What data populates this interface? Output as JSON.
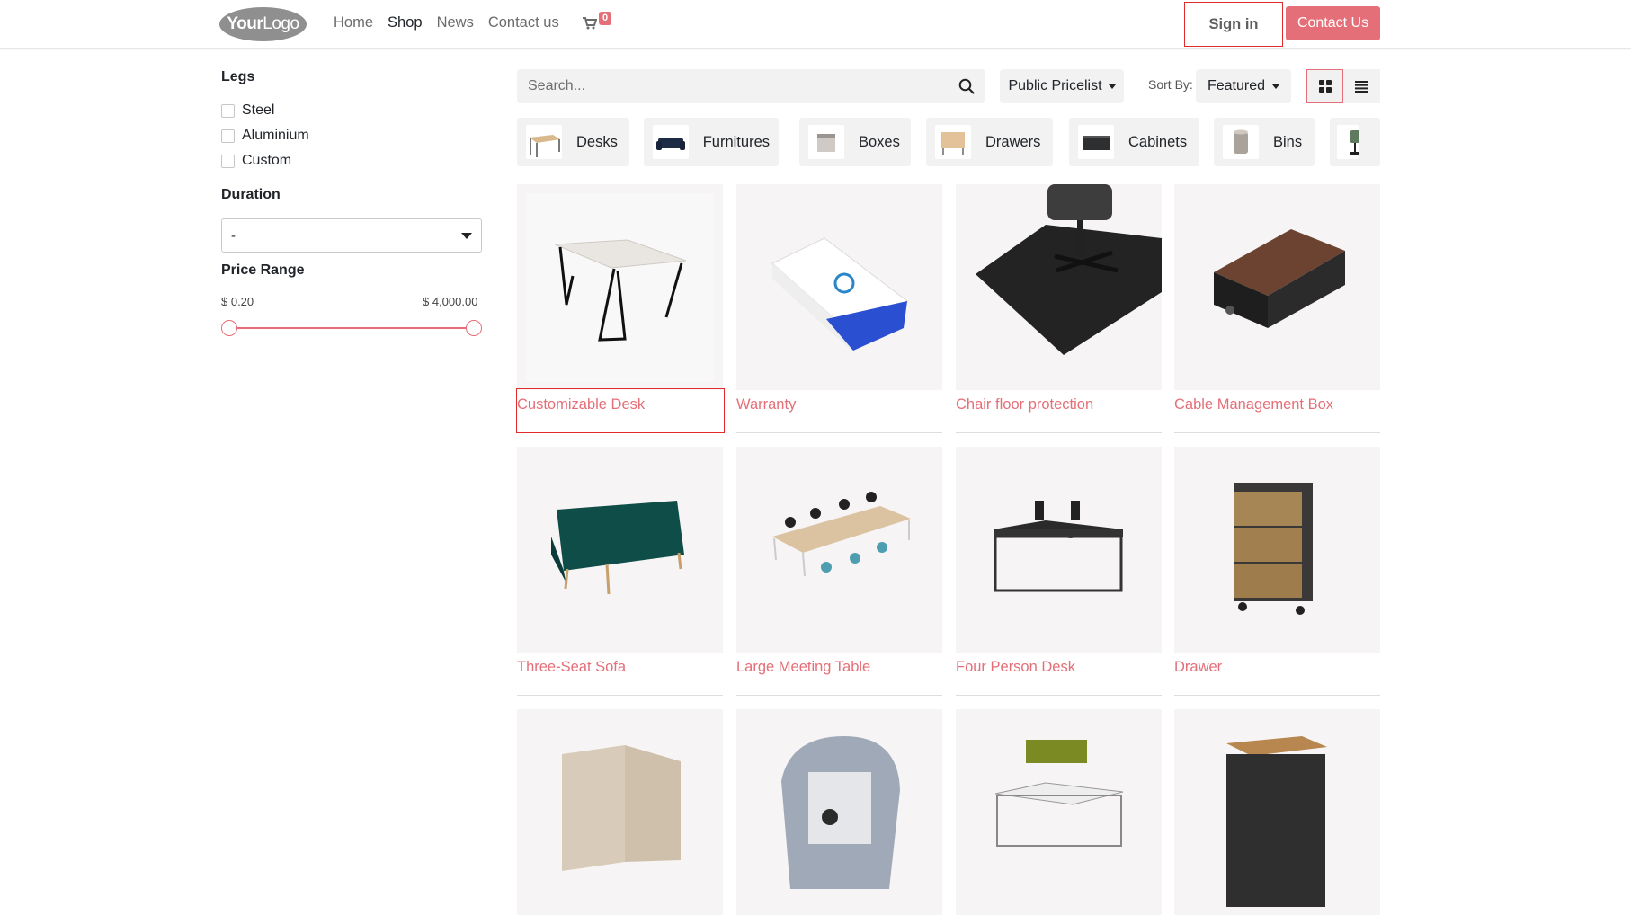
{
  "header": {
    "logo_text_bold": "Your",
    "logo_text_rest": "Logo",
    "nav": [
      "Home",
      "Shop",
      "News",
      "Contact us"
    ],
    "active_nav": "Shop",
    "cart_count": "0",
    "sign_in": "Sign in",
    "contact_button": "Contact Us"
  },
  "sidebar": {
    "legs_title": "Legs",
    "legs_options": [
      "Steel",
      "Aluminium",
      "Custom"
    ],
    "duration_title": "Duration",
    "duration_value": "-",
    "price_title": "Price Range",
    "price_min": "$ 0.20",
    "price_max": "$ 4,000.00"
  },
  "toolbar": {
    "search_placeholder": "Search...",
    "pricelist": "Public Pricelist",
    "sort_label": "Sort By:",
    "sort_value": "Featured",
    "view_mode": "grid"
  },
  "categories": [
    "Desks",
    "Furnitures",
    "Boxes",
    "Drawers",
    "Cabinets",
    "Bins",
    ""
  ],
  "products": [
    {
      "name": "Customizable Desk"
    },
    {
      "name": "Warranty"
    },
    {
      "name": "Chair floor protection"
    },
    {
      "name": "Cable Management Box"
    },
    {
      "name": "Three-Seat Sofa"
    },
    {
      "name": "Large Meeting Table"
    },
    {
      "name": "Four Person Desk"
    },
    {
      "name": "Drawer"
    },
    {
      "name": ""
    },
    {
      "name": ""
    },
    {
      "name": ""
    },
    {
      "name": ""
    }
  ],
  "colors": {
    "accent": "#e46f78",
    "highlight_border": "#e02b2b",
    "product_bg": "#f6f4f4"
  }
}
